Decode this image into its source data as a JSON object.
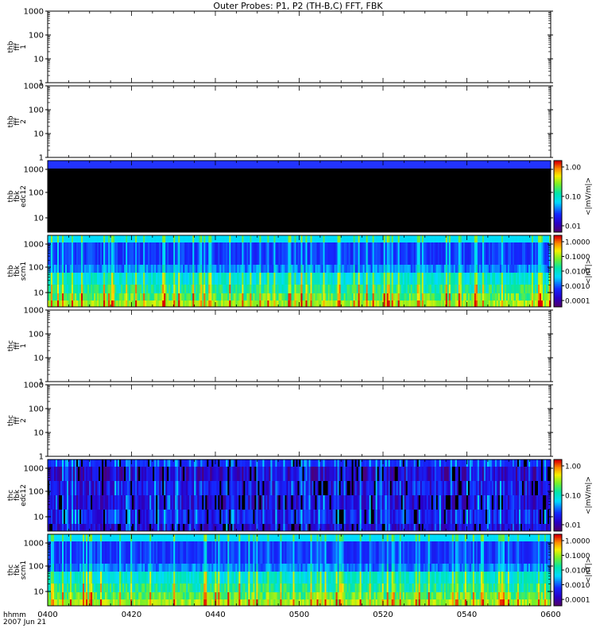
{
  "title": "Outer Probes: P1, P2 (TH-B,C) FFT, FBK",
  "x_axis": {
    "corner_label_line1": "hhmm",
    "corner_label_line2": "2007 Jun 21",
    "ticks": [
      "0400",
      "0420",
      "0440",
      "0500",
      "0520",
      "0540",
      "0600"
    ],
    "range_hhmm": [
      "04:00",
      "06:00"
    ]
  },
  "chart_data": [
    {
      "type": "heatmap",
      "ylabel": [
        "thb",
        "fff",
        "1"
      ],
      "yscale": "log",
      "ylim": [
        1,
        1000
      ],
      "yticks": [
        "1000",
        "100",
        "10",
        "1"
      ],
      "has_data": false
    },
    {
      "type": "heatmap",
      "ylabel": [
        "thb",
        "fff",
        "2"
      ],
      "yscale": "log",
      "ylim": [
        1,
        1000
      ],
      "yticks": [
        "1000",
        "100",
        "10",
        "1"
      ],
      "has_data": false
    },
    {
      "type": "heatmap",
      "ylabel": [
        "thb",
        "fbk",
        "edc12"
      ],
      "yscale": "log",
      "yticks": [
        "1000",
        "100",
        "10"
      ],
      "colorbar": {
        "label": "<|mV/m|>",
        "ticks": [
          "1.00",
          "0.10",
          "0.01"
        ]
      },
      "has_data": true,
      "style": "edc_black"
    },
    {
      "type": "heatmap",
      "ylabel": [
        "thb",
        "fbk",
        "scm1"
      ],
      "yscale": "log",
      "yticks": [
        "1000",
        "100",
        "10"
      ],
      "colorbar": {
        "label": "<|nT|>",
        "ticks": [
          "1.0000",
          "0.1000",
          "0.0100",
          "0.0010",
          "0.0001"
        ]
      },
      "has_data": true,
      "style": "scm"
    },
    {
      "type": "heatmap",
      "ylabel": [
        "thc",
        "fff",
        "1"
      ],
      "yscale": "log",
      "ylim": [
        1,
        1000
      ],
      "yticks": [
        "1000",
        "100",
        "10",
        "1"
      ],
      "has_data": false
    },
    {
      "type": "heatmap",
      "ylabel": [
        "thc",
        "fff",
        "2"
      ],
      "yscale": "log",
      "ylim": [
        1,
        1000
      ],
      "yticks": [
        "1000",
        "100",
        "10",
        "1"
      ],
      "has_data": false
    },
    {
      "type": "heatmap",
      "ylabel": [
        "thc",
        "fbk",
        "edc12"
      ],
      "yscale": "log",
      "yticks": [
        "1000",
        "100",
        "10"
      ],
      "colorbar": {
        "label": "<|mV/m|>",
        "ticks": [
          "1.00",
          "0.10",
          "0.01"
        ]
      },
      "has_data": true,
      "style": "edc_var"
    },
    {
      "type": "heatmap",
      "ylabel": [
        "thc",
        "fbk",
        "scm1"
      ],
      "yscale": "log",
      "yticks": [
        "1000",
        "100",
        "10"
      ],
      "colorbar": {
        "label": "<|nT|>",
        "ticks": [
          "1.0000",
          "0.1000",
          "0.0100",
          "0.0010",
          "0.0001"
        ]
      },
      "has_data": true,
      "style": "scm"
    }
  ]
}
